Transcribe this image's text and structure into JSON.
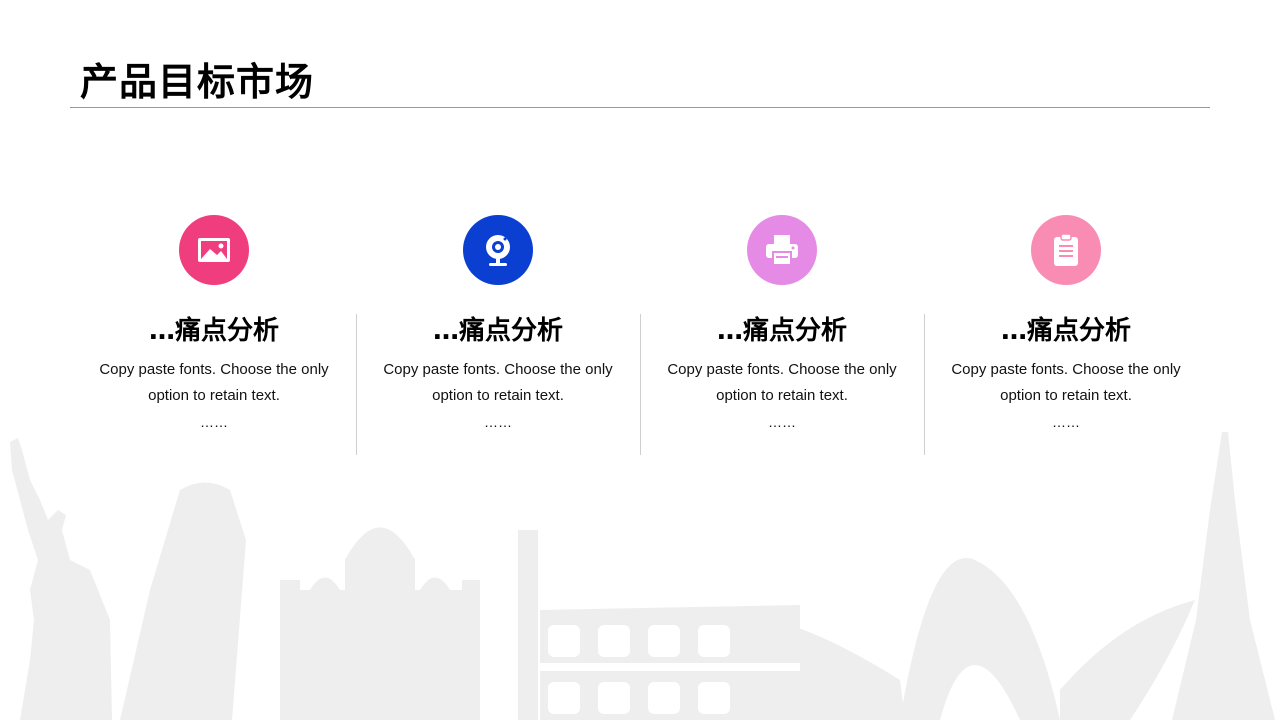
{
  "slide": {
    "title": "产品目标市场"
  },
  "columns": [
    {
      "icon": "image-icon",
      "color": "#f03d7d",
      "heading": "…痛点分析",
      "desc": "Copy paste fonts. Choose the only option to retain text.",
      "dots": "……"
    },
    {
      "icon": "webcam-icon",
      "color": "#0b3fd1",
      "heading": "…痛点分析",
      "desc": "Copy paste fonts. Choose the only option to retain text.",
      "dots": "……"
    },
    {
      "icon": "printer-icon",
      "color": "#e58ae5",
      "heading": "…痛点分析",
      "desc": "Copy paste fonts. Choose the only option to retain text.",
      "dots": "……"
    },
    {
      "icon": "clipboard-icon",
      "color": "#f98cb3",
      "heading": "…痛点分析",
      "desc": "Copy paste fonts. Choose the only option to retain text.",
      "dots": "……"
    }
  ],
  "decoration": {
    "skyline_color": "#eeeeee"
  }
}
